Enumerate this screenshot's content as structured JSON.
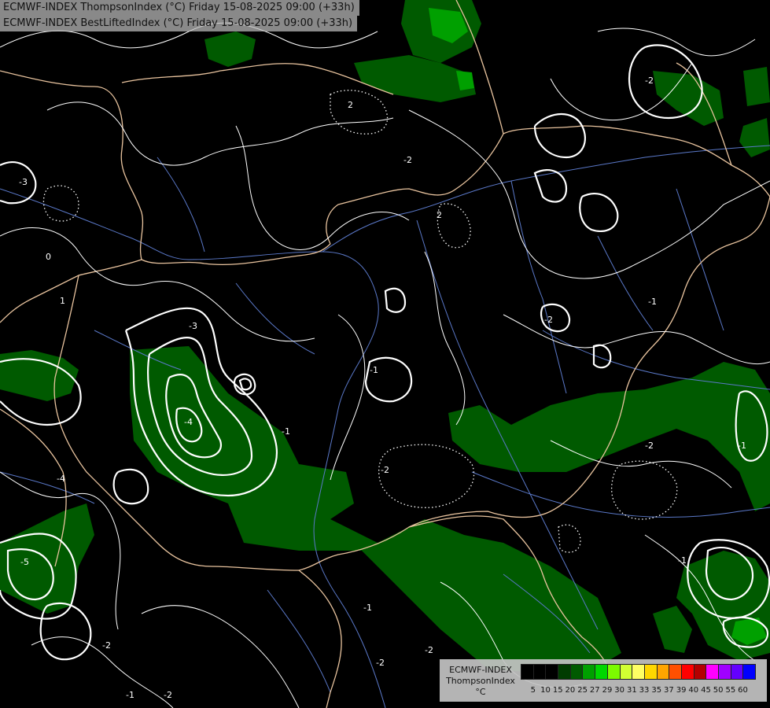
{
  "header": {
    "line1": "ECMWF-INDEX ThompsonIndex (°C) Friday 15-08-2025 09:00 (+33h)",
    "line2": "ECMWF-INDEX BestLiftedIndex (°C) Friday 15-08-2025 09:00 (+33h)"
  },
  "map": {
    "background_color": "#000000",
    "fill_color": "#005a00",
    "fill_bright_color": "#00a000",
    "contour_color": "#ffffff",
    "border_color": "#e8c39e",
    "river_color": "#5a78c8",
    "contour_labels": [
      "2",
      "-2",
      "2",
      "-2",
      "-3",
      "-1",
      "-1",
      "0",
      "-3",
      "-4",
      "-4",
      "-5",
      "-2",
      "-1",
      "-2",
      "-1",
      "-2",
      "-1",
      "-2",
      "-1",
      "-2",
      "1",
      "-1",
      "-2",
      "-2"
    ]
  },
  "legend": {
    "title_lines": [
      "ECMWF-INDEX",
      "ThompsonIndex",
      "°C"
    ],
    "ticks": [
      "5",
      "10",
      "15",
      "20",
      "25",
      "27",
      "29",
      "30",
      "31",
      "33",
      "35",
      "37",
      "39",
      "40",
      "45",
      "50",
      "55",
      "60"
    ],
    "colors": [
      "#000000",
      "#000000",
      "#000000",
      "#003c00",
      "#005a00",
      "#00a000",
      "#00d700",
      "#7cfc00",
      "#d2ff32",
      "#ffff64",
      "#ffd700",
      "#ffa500",
      "#ff5000",
      "#ff0000",
      "#b40000",
      "#ff00ff",
      "#a000ff",
      "#6400ff",
      "#0000ff"
    ]
  }
}
